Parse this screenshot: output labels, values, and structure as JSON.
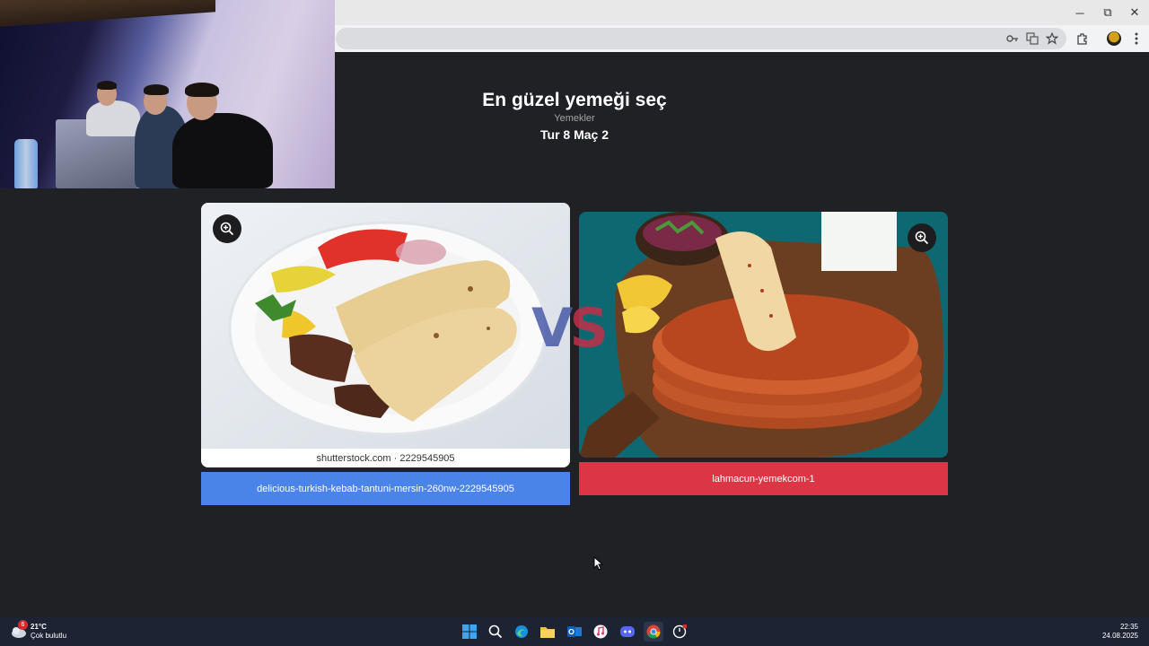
{
  "page": {
    "title": "En güzel yemeği seç",
    "subtitle": "Yemekler",
    "round": "Tur 8 Maç 2"
  },
  "vs": {
    "v": "V",
    "s": "S"
  },
  "left_choice": {
    "label": "delicious-turkish-kebab-tantuni-mersin-260nw-2229545905",
    "watermark": "shutterstock.com · 2229545905",
    "color": "#4b84e8"
  },
  "right_choice": {
    "label": "lahmacun-yemekcom-1",
    "color": "#dc3545"
  },
  "window_controls": {
    "minimize": "─",
    "restore": "⧉",
    "close": "✕"
  },
  "taskbar": {
    "weather_badge": "6",
    "temperature": "21°C",
    "weather": "Çok bulutlu",
    "time": "22:35",
    "date": "24.08.2025",
    "apps": [
      "windows-start",
      "search",
      "edge",
      "file-explorer",
      "outlook",
      "music",
      "discord",
      "chrome",
      "app-with-badge"
    ]
  }
}
